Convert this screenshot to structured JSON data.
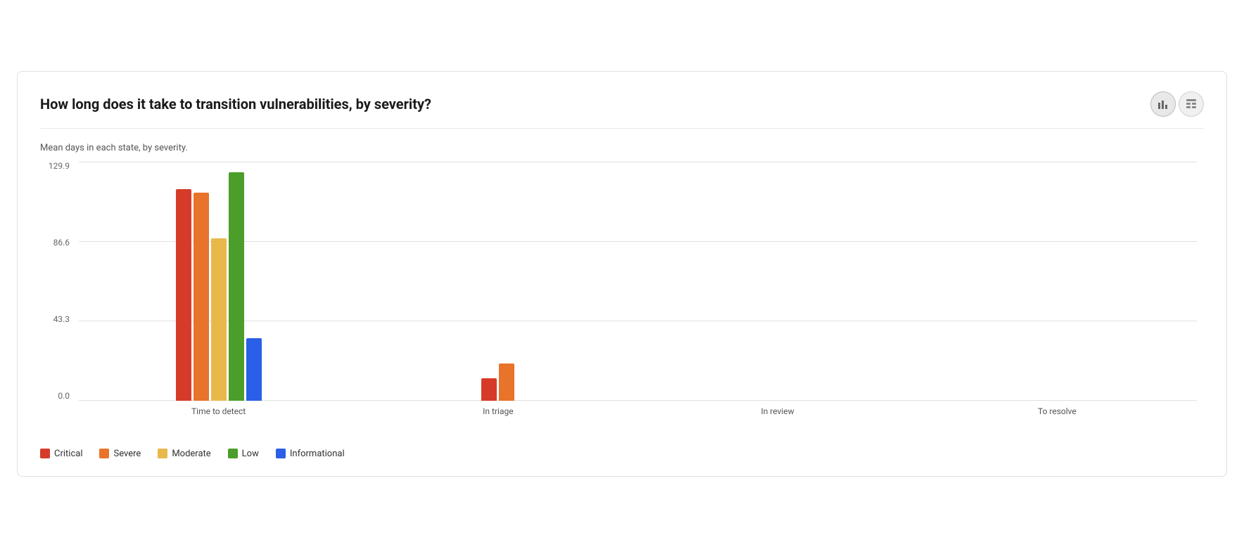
{
  "header": {
    "title": "How long does it take to transition vulnerabilities, by severity?",
    "chart_view_label": "bar chart view",
    "table_view_label": "table view"
  },
  "subtitle": "Mean days in each state, by severity.",
  "y_axis": {
    "labels": [
      "129.9",
      "86.6",
      "43.3",
      "0.0"
    ]
  },
  "x_axis": {
    "labels": [
      "Time to detect",
      "In triage",
      "In review",
      "To resolve"
    ]
  },
  "chart": {
    "max_value": 129.9,
    "groups": [
      {
        "name": "Time to detect",
        "bars": [
          {
            "severity": "Critical",
            "value": 115,
            "color": "#d63b2a"
          },
          {
            "severity": "Severe",
            "value": 113,
            "color": "#e8732a"
          },
          {
            "severity": "Moderate",
            "value": 88,
            "color": "#e8b84b"
          },
          {
            "severity": "Low",
            "value": 124,
            "color": "#4a9e29"
          },
          {
            "severity": "Informational",
            "value": 34,
            "color": "#2a5fe8"
          }
        ]
      },
      {
        "name": "In triage",
        "bars": [
          {
            "severity": "Critical",
            "value": 12,
            "color": "#d63b2a"
          },
          {
            "severity": "Severe",
            "value": 20,
            "color": "#e8732a"
          },
          {
            "severity": "Moderate",
            "value": 0,
            "color": "#e8b84b"
          },
          {
            "severity": "Low",
            "value": 0,
            "color": "#4a9e29"
          },
          {
            "severity": "Informational",
            "value": 0,
            "color": "#2a5fe8"
          }
        ]
      },
      {
        "name": "In review",
        "bars": [
          {
            "severity": "Critical",
            "value": 0,
            "color": "#d63b2a"
          },
          {
            "severity": "Severe",
            "value": 0,
            "color": "#e8732a"
          },
          {
            "severity": "Moderate",
            "value": 0,
            "color": "#e8b84b"
          },
          {
            "severity": "Low",
            "value": 0,
            "color": "#4a9e29"
          },
          {
            "severity": "Informational",
            "value": 0,
            "color": "#2a5fe8"
          }
        ]
      },
      {
        "name": "To resolve",
        "bars": [
          {
            "severity": "Critical",
            "value": 0,
            "color": "#d63b2a"
          },
          {
            "severity": "Severe",
            "value": 0,
            "color": "#e8732a"
          },
          {
            "severity": "Moderate",
            "value": 0,
            "color": "#e8b84b"
          },
          {
            "severity": "Low",
            "value": 0,
            "color": "#4a9e29"
          },
          {
            "severity": "Informational",
            "value": 0,
            "color": "#2a5fe8"
          }
        ]
      }
    ]
  },
  "legend": {
    "items": [
      {
        "label": "Critical",
        "color": "#d63b2a"
      },
      {
        "label": "Severe",
        "color": "#e8732a"
      },
      {
        "label": "Moderate",
        "color": "#e8b84b"
      },
      {
        "label": "Low",
        "color": "#4a9e29"
      },
      {
        "label": "Informational",
        "color": "#2a5fe8"
      }
    ]
  },
  "icons": {
    "bar_chart": "▐▌",
    "table": "⊞"
  }
}
